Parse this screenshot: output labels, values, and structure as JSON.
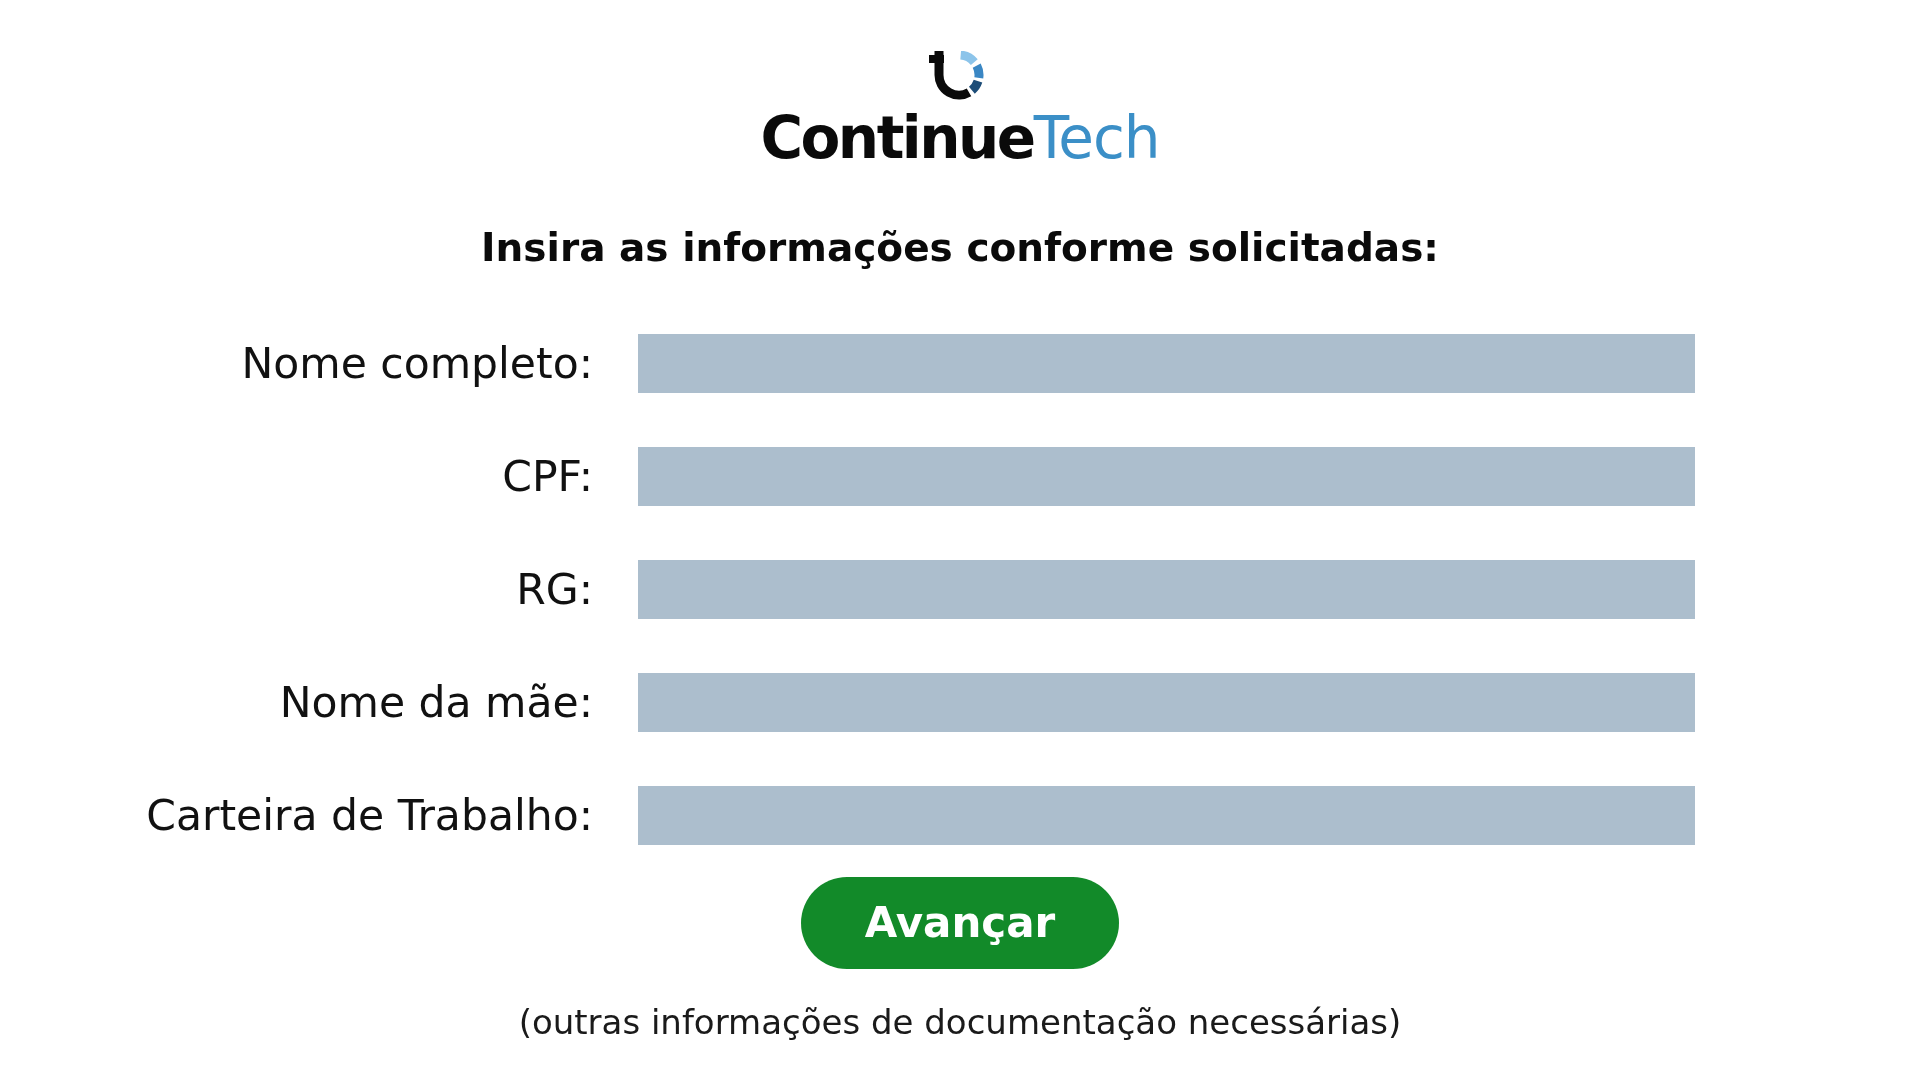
{
  "logo": {
    "wordmark": [
      {
        "text": "Continue",
        "kind": "strong"
      },
      {
        "text": "Tech",
        "kind": "light"
      }
    ]
  },
  "heading": "Insira as informações conforme solicitadas:",
  "fields": [
    {
      "label": "Nome completo:"
    },
    {
      "label": "CPF:"
    },
    {
      "label": "RG:"
    },
    {
      "label": "Nome da mãe:"
    },
    {
      "label": "Carteira de Trabalho:"
    }
  ],
  "submit_button": {
    "label": "Avançar"
  },
  "footnote": "(outras informações de documentação necessárias)"
}
